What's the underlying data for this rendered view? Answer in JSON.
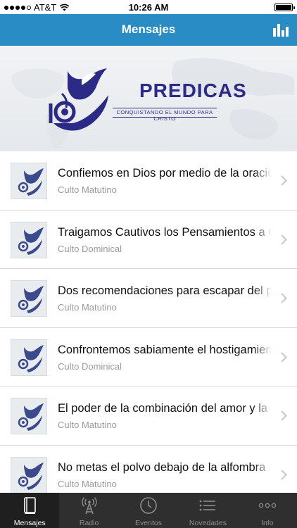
{
  "status_bar": {
    "carrier": "AT&T",
    "time": "10:26 AM"
  },
  "header": {
    "title": "Mensajes",
    "accent_color": "#2a8cc4"
  },
  "banner": {
    "title": "PREDICAS",
    "tagline": "CONQUISTANDO EL MUNDO PARA CRISTO",
    "brand_color": "#2b2a86"
  },
  "messages": [
    {
      "title": "Confiemos en Dios por medio de la oración",
      "subtitle": "Culto Matutino"
    },
    {
      "title": "Traigamos Cautivos los Pensamientos a Cristo",
      "subtitle": "Culto Dominical"
    },
    {
      "title": "Dos recomendaciones para escapar del pecado",
      "subtitle": "Culto Matutino"
    },
    {
      "title": "Confrontemos sabiamente el hostigamiento",
      "subtitle": "Culto Dominical"
    },
    {
      "title": "El poder de la combinación del amor y la fe",
      "subtitle": "Culto Matutino"
    },
    {
      "title": "No metas el polvo debajo de la alfombra",
      "subtitle": "Culto Matutino"
    }
  ],
  "tabs": [
    {
      "label": "Mensajes",
      "icon": "book-icon",
      "active": true
    },
    {
      "label": "Radio",
      "icon": "radio-tower-icon",
      "active": false
    },
    {
      "label": "Eventos",
      "icon": "clock-icon",
      "active": false
    },
    {
      "label": "Novedades",
      "icon": "list-icon",
      "active": false
    },
    {
      "label": "Info",
      "icon": "more-icon",
      "active": false
    }
  ]
}
